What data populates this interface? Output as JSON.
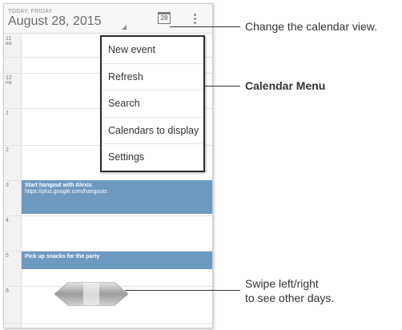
{
  "header": {
    "day": "TODAY, FRIDAY",
    "date": "August 28, 2015",
    "calendar_icon_text": "28"
  },
  "hours": [
    {
      "num": "11",
      "ampm": "AM"
    },
    {
      "num": "12",
      "ampm": "PM"
    },
    {
      "num": "1",
      "ampm": ""
    },
    {
      "num": "2",
      "ampm": ""
    },
    {
      "num": "3",
      "ampm": ""
    },
    {
      "num": "4",
      "ampm": ""
    },
    {
      "num": "5",
      "ampm": ""
    },
    {
      "num": "6",
      "ampm": ""
    }
  ],
  "events": [
    {
      "title": "Start hangout with Alexis",
      "subtitle": "https://plus.google.com/hangouts"
    },
    {
      "title": "Pick up snacks for the party",
      "subtitle": ""
    }
  ],
  "menu": {
    "items": [
      "New event",
      "Refresh",
      "Search",
      "Calendars to display",
      "Settings"
    ]
  },
  "callouts": {
    "view": "Change the calendar view.",
    "menu": "Calendar Menu",
    "swipe_line1": "Swipe left/right",
    "swipe_line2": "to see other days."
  },
  "colors": {
    "event": "#6e99c1",
    "menu_border": "#2c2c2c"
  }
}
